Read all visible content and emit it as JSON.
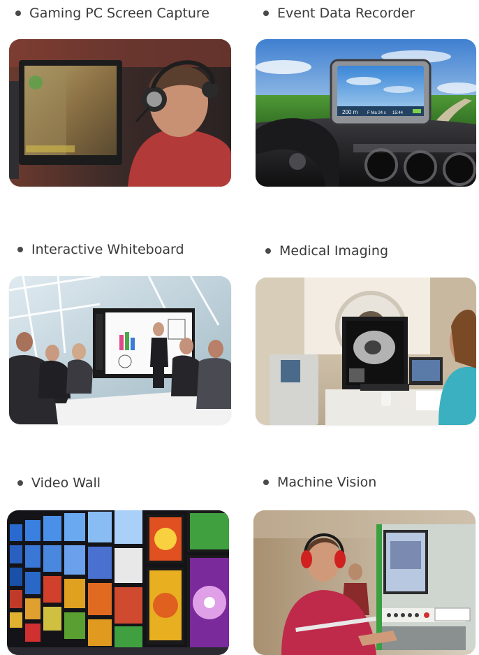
{
  "items": [
    {
      "label": "Gaming PC Screen Capture"
    },
    {
      "label": "Event Data Recorder"
    },
    {
      "label": "Interactive Whiteboard"
    },
    {
      "label": "Medical Imaging"
    },
    {
      "label": "Video Wall"
    },
    {
      "label": "Machine Vision"
    }
  ],
  "recorder_screen": {
    "distance": "200 m",
    "info": "F Ma 24 s",
    "time": "15:44"
  },
  "colors": {
    "text": "#3a3a3a",
    "bullet": "#4a4a4a"
  }
}
